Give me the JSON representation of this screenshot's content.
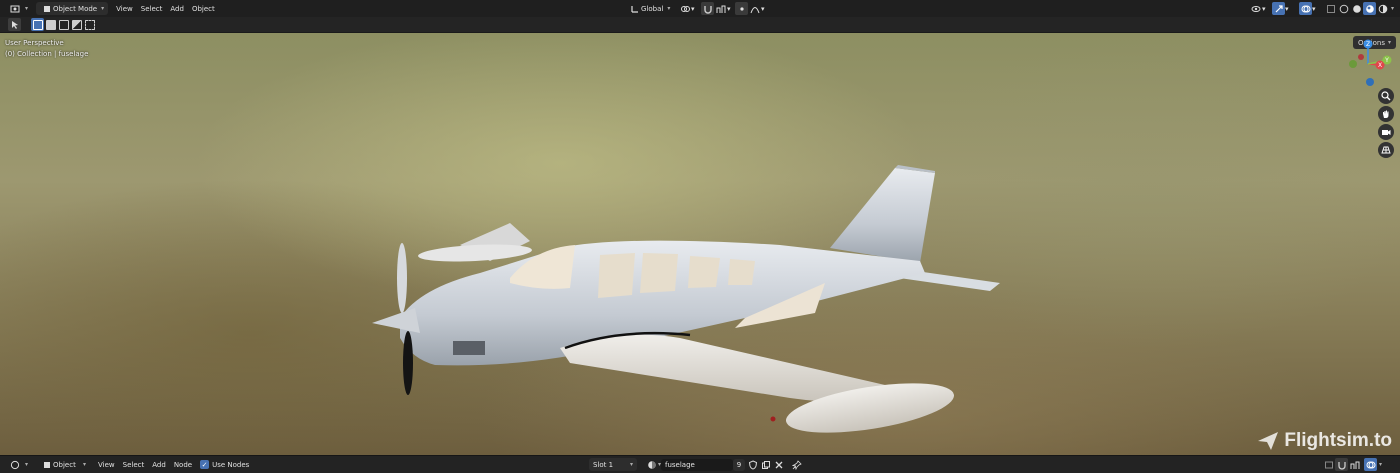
{
  "top_header": {
    "mode_label": "Object Mode",
    "menus": [
      "View",
      "Select",
      "Add",
      "Object"
    ],
    "orientation_label": "Global"
  },
  "viewport": {
    "perspective_label": "User Perspective",
    "collection_label": "(0) Collection | fuselage",
    "options_label": "Options",
    "gizmo": {
      "x": "X",
      "y": "Y",
      "z": "Z"
    }
  },
  "bottom_header": {
    "object_label": "Object",
    "menus": [
      "View",
      "Select",
      "Add",
      "Node"
    ],
    "use_nodes_label": "Use Nodes",
    "slot_label": "Slot 1",
    "material_name": "fuselage",
    "user_count": "9"
  },
  "watermark": {
    "text": "Flightsim.to"
  },
  "colors": {
    "accent": "#4772b3",
    "x_axis": "#e0464b",
    "y_axis": "#8bc34a",
    "z_axis": "#3a8ee6"
  }
}
